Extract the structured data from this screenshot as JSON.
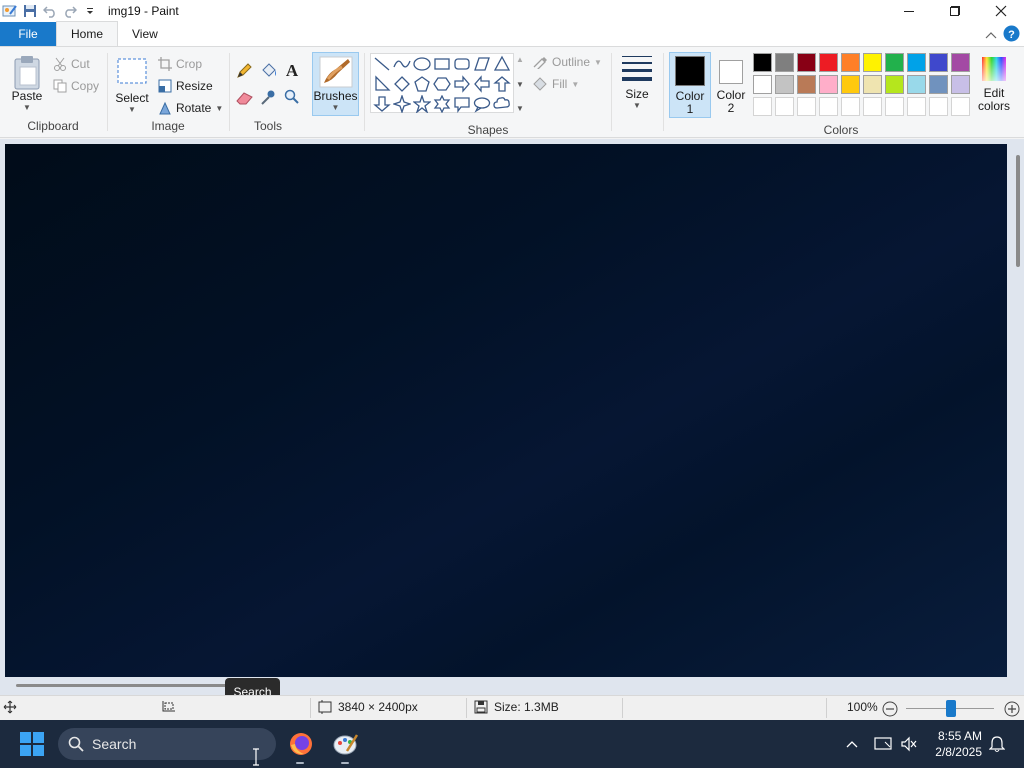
{
  "window": {
    "title": "img19 - Paint"
  },
  "tabs": {
    "file": "File",
    "home": "Home",
    "view": "View"
  },
  "ribbon": {
    "clipboard": {
      "label": "Clipboard",
      "paste": "Paste",
      "cut": "Cut",
      "copy": "Copy"
    },
    "image": {
      "label": "Image",
      "select": "Select",
      "crop": "Crop",
      "resize": "Resize",
      "rotate": "Rotate"
    },
    "tools": {
      "label": "Tools"
    },
    "brushes": {
      "label": "Brushes"
    },
    "shapes": {
      "label": "Shapes",
      "outline": "Outline",
      "fill": "Fill"
    },
    "size": {
      "label": "Size"
    },
    "colors": {
      "label": "Colors",
      "color1_line1": "Color",
      "color1_line2": "1",
      "color2_line1": "Color",
      "color2_line2": "2",
      "edit_line1": "Edit",
      "edit_line2": "colors",
      "color1": "#000000",
      "color2": "#ffffff",
      "palette_row1": [
        "#000000",
        "#7f7f7f",
        "#880015",
        "#ed1c24",
        "#ff7f27",
        "#fff200",
        "#22b14c",
        "#00a2e8",
        "#3f48cc",
        "#a349a4"
      ],
      "palette_row2": [
        "#ffffff",
        "#c3c3c3",
        "#b97a57",
        "#ffaec9",
        "#ffc90e",
        "#efe4b0",
        "#b5e61d",
        "#99d9ea",
        "#7092be",
        "#c8bfe7"
      ],
      "palette_row3": [
        "#ffffff",
        "#ffffff",
        "#ffffff",
        "#ffffff",
        "#ffffff",
        "#ffffff",
        "#ffffff",
        "#ffffff",
        "#ffffff",
        "#ffffff"
      ]
    }
  },
  "tooltip": "Search",
  "status": {
    "dimensions": "3840 × 2400px",
    "size": "Size: 1.3MB",
    "zoom": "100%"
  },
  "taskbar": {
    "search_placeholder": "Search",
    "time": "8:55 AM",
    "date": "2/8/2025"
  }
}
